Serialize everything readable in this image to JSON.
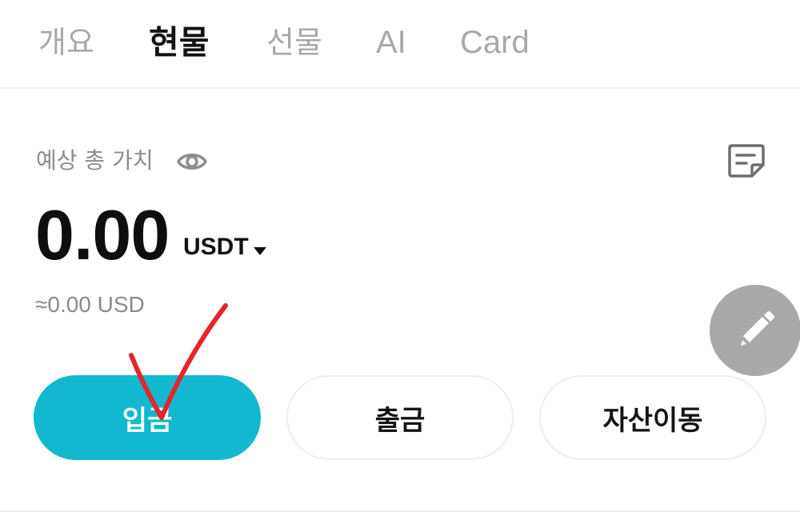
{
  "tabs": [
    {
      "label": "개요",
      "active": false
    },
    {
      "label": "현물",
      "active": true
    },
    {
      "label": "선물",
      "active": false
    },
    {
      "label": "AI",
      "active": false
    },
    {
      "label": "Card",
      "active": false
    }
  ],
  "summary": {
    "estimated_label": "예상 총 가치",
    "balance": "0.00",
    "currency": "USDT",
    "usd_approx": "≈0.00 USD"
  },
  "icons": {
    "visibility": "eye-icon",
    "records": "notes-icon",
    "edit": "pencil-icon",
    "currency_dropdown": "caret-down-icon"
  },
  "actions": {
    "deposit_label": "입금",
    "withdraw_label": "출금",
    "transfer_label": "자산이동"
  },
  "colors": {
    "accent": "#12b8cf",
    "fab": "#a9a9a9",
    "annotation": "#e3262c"
  }
}
